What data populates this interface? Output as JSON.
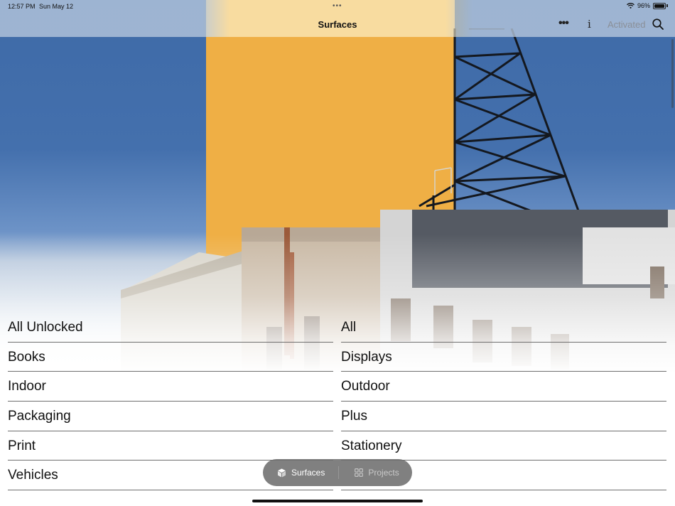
{
  "status_bar": {
    "time": "12:57 PM",
    "date": "Sun May 12",
    "battery": "96%",
    "multitask_dots": "•••"
  },
  "nav": {
    "title": "Surfaces",
    "more_icon": "ellipsis-icon",
    "info_label": "i",
    "activated_label": "Activated",
    "search_icon": "magnifier-icon"
  },
  "categories": {
    "left": [
      "All Unlocked",
      "Books",
      "Indoor",
      "Packaging",
      "Print",
      "Vehicles"
    ],
    "right": [
      "All",
      "Displays",
      "Outdoor",
      "Plus",
      "Stationery"
    ]
  },
  "tab_bar": {
    "surfaces_label": "Surfaces",
    "projects_label": "Projects"
  },
  "colors": {
    "billboard": "#efaf45",
    "sky": "#4470ad",
    "tab_bar_bg": "#6e6e6e",
    "activated_text": "#8a8f98"
  }
}
